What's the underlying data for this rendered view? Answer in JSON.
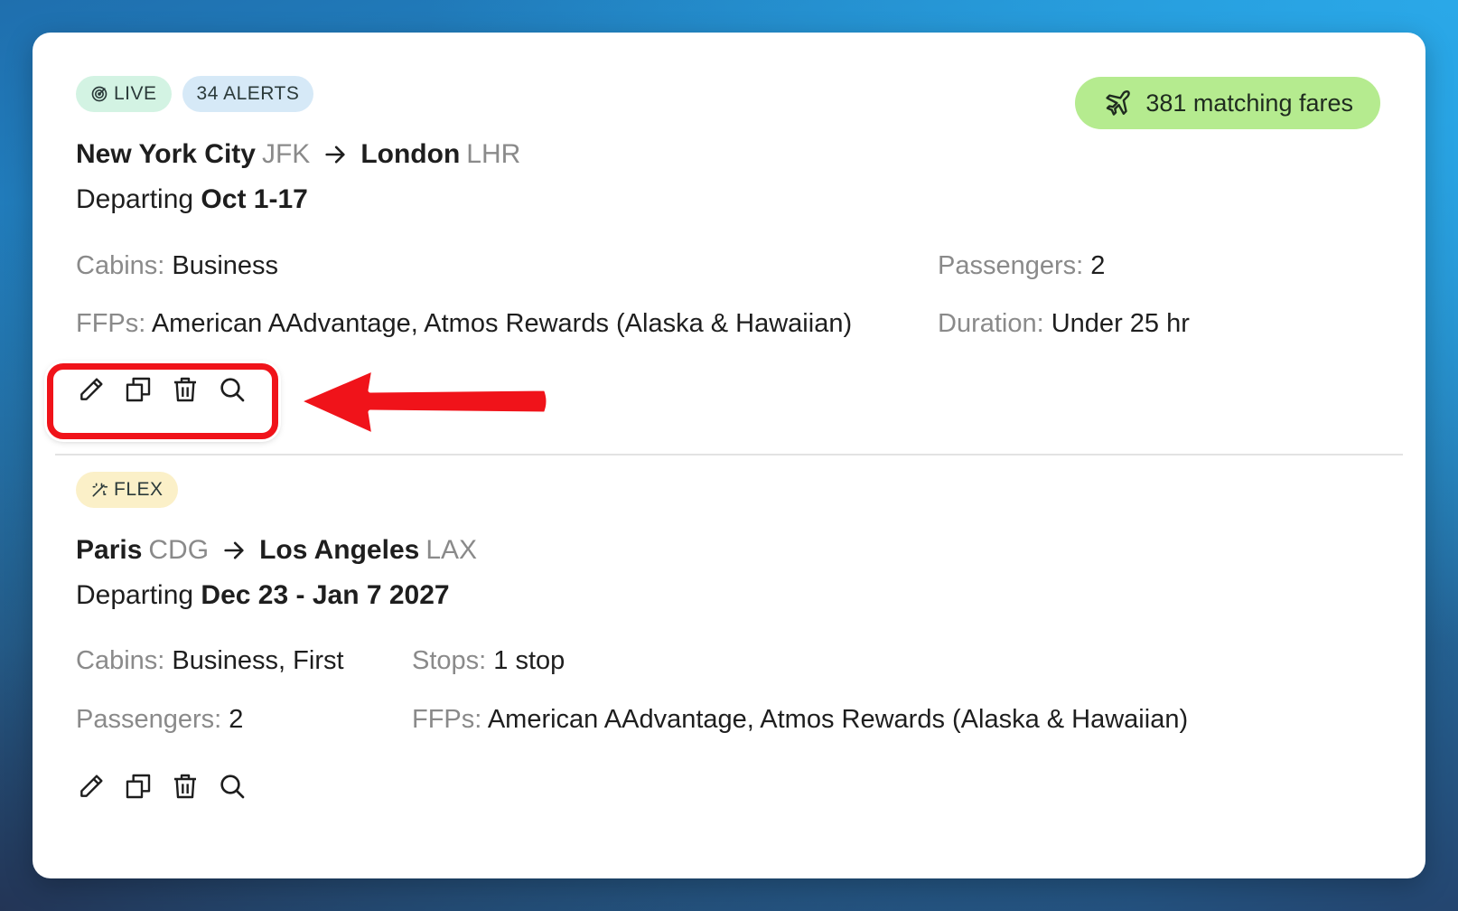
{
  "alerts": [
    {
      "badges": [
        {
          "type": "live",
          "icon": "radar-icon",
          "label": "LIVE"
        },
        {
          "type": "alerts",
          "label": "34 ALERTS"
        }
      ],
      "matching_fares": {
        "icon": "plane-icon",
        "label": "381 matching fares"
      },
      "origin_city": "New York City",
      "origin_code": "JFK",
      "dest_city": "London",
      "dest_code": "LHR",
      "departing_label": "Departing",
      "departing_dates": "Oct 1-17",
      "fields": {
        "cabins": {
          "label": "Cabins:",
          "value": "Business"
        },
        "passengers": {
          "label": "Passengers:",
          "value": "2"
        },
        "ffps": {
          "label": "FFPs:",
          "value": "American AAdvantage, Atmos Rewards (Alaska & Hawaiian)"
        },
        "duration": {
          "label": "Duration:",
          "value": "Under 25 hr"
        }
      }
    },
    {
      "badges": [
        {
          "type": "flex",
          "icon": "magic-wand-icon",
          "label": "FLEX"
        }
      ],
      "origin_city": "Paris",
      "origin_code": "CDG",
      "dest_city": "Los Angeles",
      "dest_code": "LAX",
      "departing_label": "Departing",
      "departing_dates": "Dec 23 - Jan 7 2027",
      "fields": {
        "cabins": {
          "label": "Cabins:",
          "value": "Business, First"
        },
        "stops": {
          "label": "Stops:",
          "value": "1 stop"
        },
        "passengers": {
          "label": "Passengers:",
          "value": "2"
        },
        "ffps": {
          "label": "FFPs:",
          "value": "American AAdvantage, Atmos Rewards (Alaska & Hawaiian)"
        }
      }
    }
  ],
  "action_icons": [
    "edit-pencil-icon",
    "duplicate-icon",
    "trash-icon",
    "search-icon"
  ],
  "annotation": {
    "highlight_color": "#f0131a"
  },
  "colors": {
    "live_badge": "#d3f3e3",
    "alerts_badge": "#d6e9f7",
    "flex_badge": "#fbf0c8",
    "fares_pill": "#b5eb8f"
  }
}
